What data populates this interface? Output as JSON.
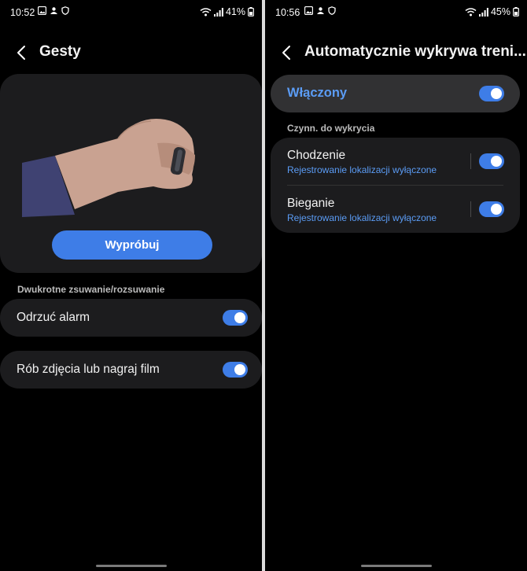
{
  "left": {
    "status": {
      "time": "10:52",
      "battery": "41%"
    },
    "header": {
      "title": "Gesty"
    },
    "try_button": "Wypróbuj",
    "section_label": "Dwukrotne zsuwanie/rozsuwanie",
    "rows": [
      {
        "label": "Odrzuć alarm",
        "toggle_on": true
      },
      {
        "label": "Rób zdjęcia lub nagraj film",
        "toggle_on": true
      }
    ]
  },
  "right": {
    "status": {
      "time": "10:56",
      "battery": "45%"
    },
    "header": {
      "title": "Automatycznie wykrywa treni..."
    },
    "master": {
      "label": "Włączony",
      "toggle_on": true
    },
    "section_label": "Czynn. do wykrycia",
    "rows": [
      {
        "label": "Chodzenie",
        "sub": "Rejestrowanie lokalizacji wyłączone",
        "toggle_on": true
      },
      {
        "label": "Bieganie",
        "sub": "Rejestrowanie lokalizacji wyłączone",
        "toggle_on": true
      }
    ]
  },
  "colors": {
    "accent": "#3e7de7",
    "link": "#5b9cf5",
    "card": "#1c1c1e",
    "background": "#000000"
  },
  "icons": [
    "gallery-icon",
    "notification-icon",
    "shield-icon",
    "wifi-icon",
    "signal-icon",
    "battery-icon",
    "back-arrow-icon",
    "toggle-switch",
    "ring-icon"
  ]
}
